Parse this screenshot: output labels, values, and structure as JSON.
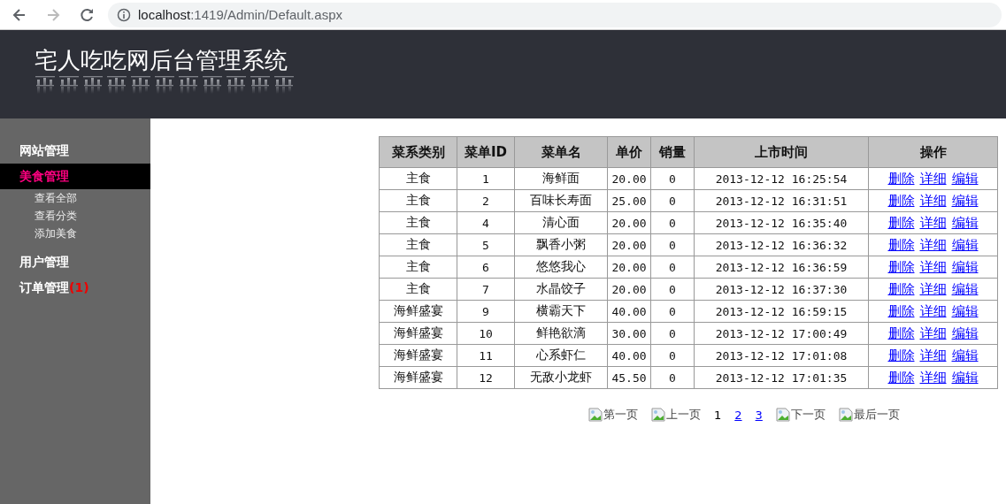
{
  "browser": {
    "url_host": "localhost",
    "url_path": ":1419/Admin/Default.aspx"
  },
  "header": {
    "title": "宅人吃吃网后台管理系统"
  },
  "sidebar": {
    "items": [
      {
        "label": "网站管理",
        "selected": false
      },
      {
        "label": "美食管理",
        "selected": true,
        "children": [
          {
            "label": "查看全部"
          },
          {
            "label": "查看分类"
          },
          {
            "label": "添加美食"
          }
        ]
      },
      {
        "label": "用户管理",
        "selected": false
      },
      {
        "label": "订单管理",
        "selected": false,
        "badge": "(1)"
      }
    ]
  },
  "table": {
    "columns": [
      "菜系类别",
      "菜单ID",
      "菜单名",
      "单价",
      "销量",
      "上市时间",
      "操作"
    ],
    "rows": [
      {
        "category": "主食",
        "id": "1",
        "name": "海鲜面",
        "price": "20.00",
        "sales": "0",
        "time": "2013-12-12 16:25:54",
        "actions": [
          "删除",
          "详细",
          "编辑"
        ]
      },
      {
        "category": "主食",
        "id": "2",
        "name": "百味长寿面",
        "price": "25.00",
        "sales": "0",
        "time": "2013-12-12 16:31:51",
        "actions": [
          "删除",
          "详细",
          "编辑"
        ]
      },
      {
        "category": "主食",
        "id": "4",
        "name": "清心面",
        "price": "20.00",
        "sales": "0",
        "time": "2013-12-12 16:35:40",
        "actions": [
          "删除",
          "详细",
          "编辑"
        ]
      },
      {
        "category": "主食",
        "id": "5",
        "name": "飘香小粥",
        "price": "20.00",
        "sales": "0",
        "time": "2013-12-12 16:36:32",
        "actions": [
          "删除",
          "详细",
          "编辑"
        ]
      },
      {
        "category": "主食",
        "id": "6",
        "name": "悠悠我心",
        "price": "20.00",
        "sales": "0",
        "time": "2013-12-12 16:36:59",
        "actions": [
          "删除",
          "详细",
          "编辑"
        ]
      },
      {
        "category": "主食",
        "id": "7",
        "name": "水晶饺子",
        "price": "20.00",
        "sales": "0",
        "time": "2013-12-12 16:37:30",
        "actions": [
          "删除",
          "详细",
          "编辑"
        ]
      },
      {
        "category": "海鲜盛宴",
        "id": "9",
        "name": "横霸天下",
        "price": "40.00",
        "sales": "0",
        "time": "2013-12-12 16:59:15",
        "actions": [
          "删除",
          "详细",
          "编辑"
        ]
      },
      {
        "category": "海鲜盛宴",
        "id": "10",
        "name": "鲜艳欲滴",
        "price": "30.00",
        "sales": "0",
        "time": "2013-12-12 17:00:49",
        "actions": [
          "删除",
          "详细",
          "编辑"
        ]
      },
      {
        "category": "海鲜盛宴",
        "id": "11",
        "name": "心系虾仁",
        "price": "40.00",
        "sales": "0",
        "time": "2013-12-12 17:01:08",
        "actions": [
          "删除",
          "详细",
          "编辑"
        ]
      },
      {
        "category": "海鲜盛宴",
        "id": "12",
        "name": "无敌小龙虾",
        "price": "45.50",
        "sales": "0",
        "time": "2013-12-12 17:01:35",
        "actions": [
          "删除",
          "详细",
          "编辑"
        ]
      }
    ]
  },
  "pager": [
    {
      "kind": "image-link",
      "label": "第一页"
    },
    {
      "kind": "image-link",
      "label": "上一页"
    },
    {
      "kind": "page",
      "label": "1",
      "selected": true
    },
    {
      "kind": "page",
      "label": "2",
      "selected": false
    },
    {
      "kind": "page",
      "label": "3",
      "selected": false
    },
    {
      "kind": "image-link",
      "label": "下一页"
    },
    {
      "kind": "image-link",
      "label": "最后一页"
    }
  ]
}
